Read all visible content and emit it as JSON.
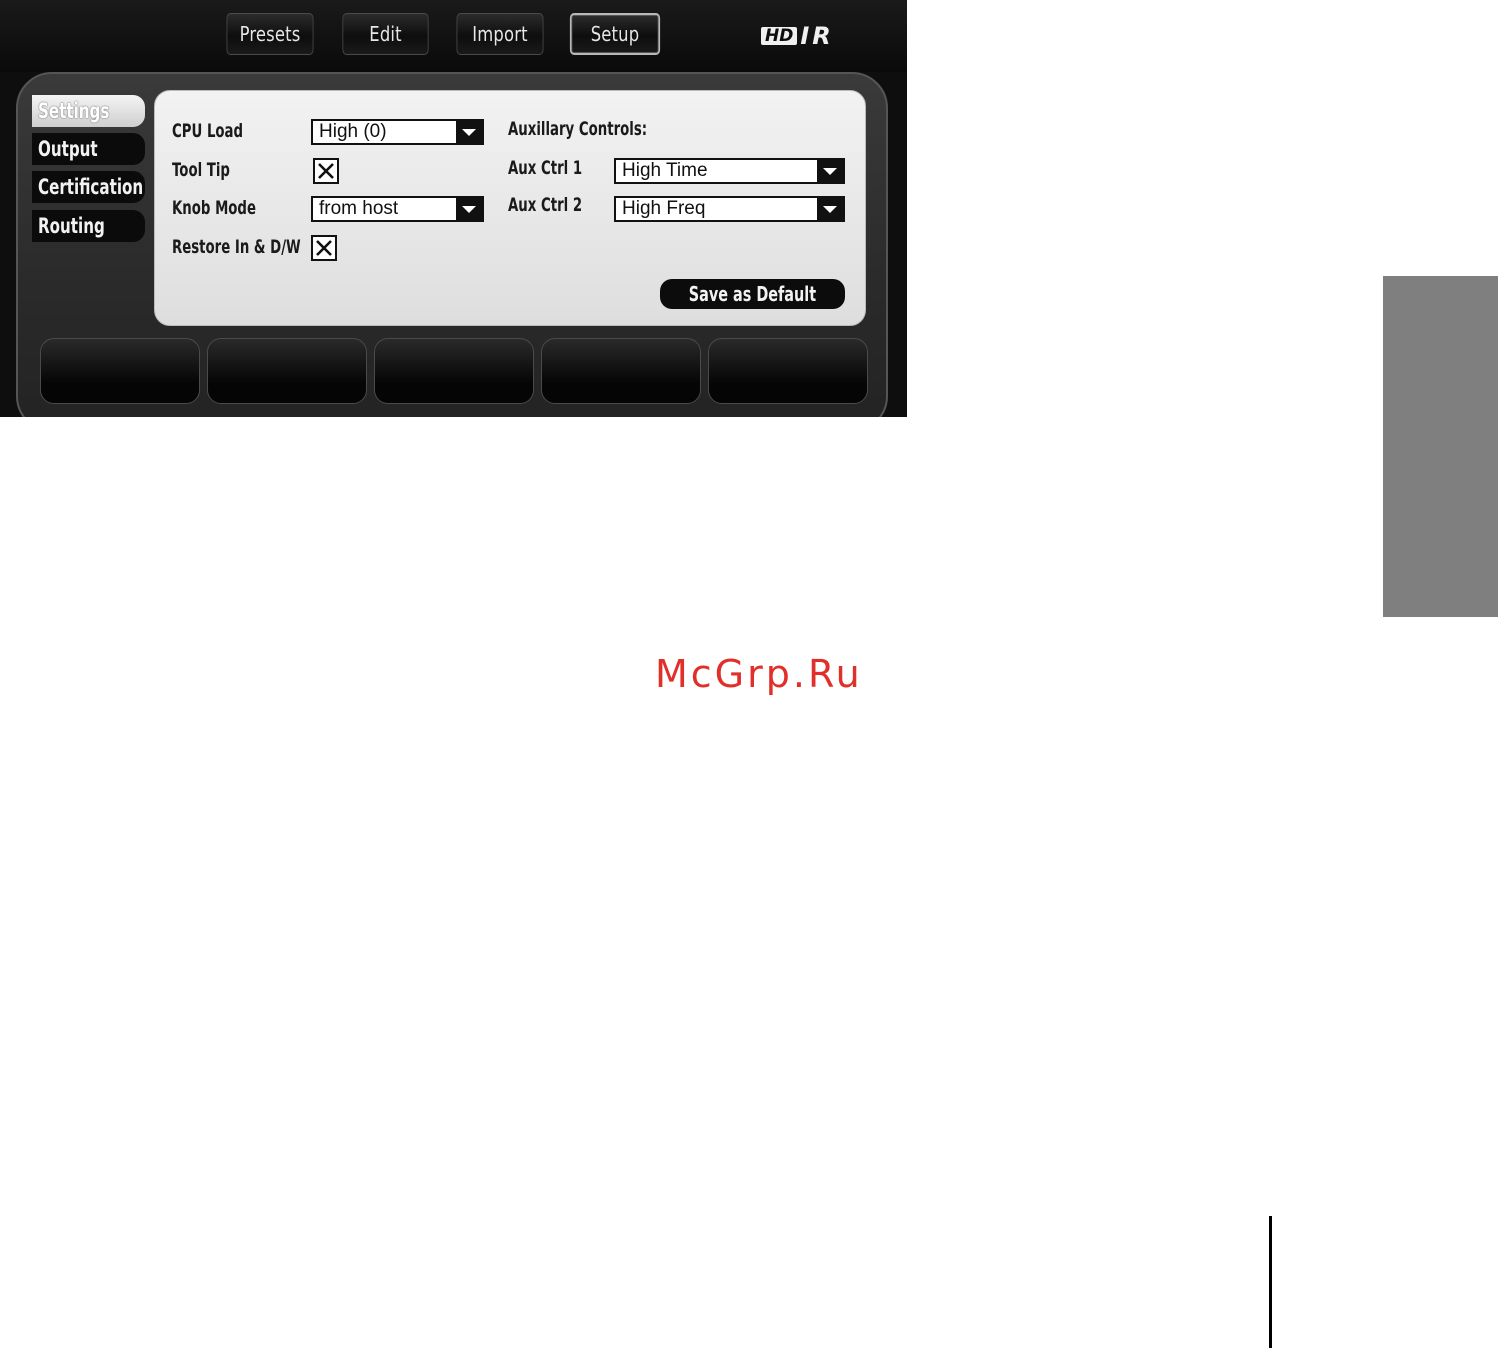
{
  "header": {
    "tabs": [
      {
        "label": "Presets",
        "active": false
      },
      {
        "label": "Edit",
        "active": false
      },
      {
        "label": "Import",
        "active": false
      },
      {
        "label": "Setup",
        "active": true
      }
    ],
    "logo": {
      "badge": "HD",
      "text": "IR"
    }
  },
  "sidebar": {
    "items": [
      {
        "label": "Settings",
        "active": true
      },
      {
        "label": "Output",
        "active": false
      },
      {
        "label": "Certification",
        "active": false
      },
      {
        "label": "Routing",
        "active": false
      }
    ]
  },
  "settings": {
    "cpu_load": {
      "label": "CPU Load",
      "value": "High (0)"
    },
    "tool_tip": {
      "label": "Tool Tip",
      "checked": true
    },
    "knob_mode": {
      "label": "Knob Mode",
      "value": "from host"
    },
    "restore": {
      "label": "Restore In & D/W",
      "checked": true
    },
    "aux_heading": "Auxillary Controls:",
    "aux1": {
      "label": "Aux Ctrl 1",
      "value": "High Time"
    },
    "aux2": {
      "label": "Aux Ctrl 2",
      "value": "High Freq"
    },
    "save_label": "Save as Default"
  },
  "page": {
    "watermark": "McGrp.Ru",
    "side_tab_color": "#7f7f7f"
  },
  "colors": {
    "window_bg": "#0e0e0e",
    "panel_bg": "#ececec",
    "watermark": "#e0302a"
  }
}
